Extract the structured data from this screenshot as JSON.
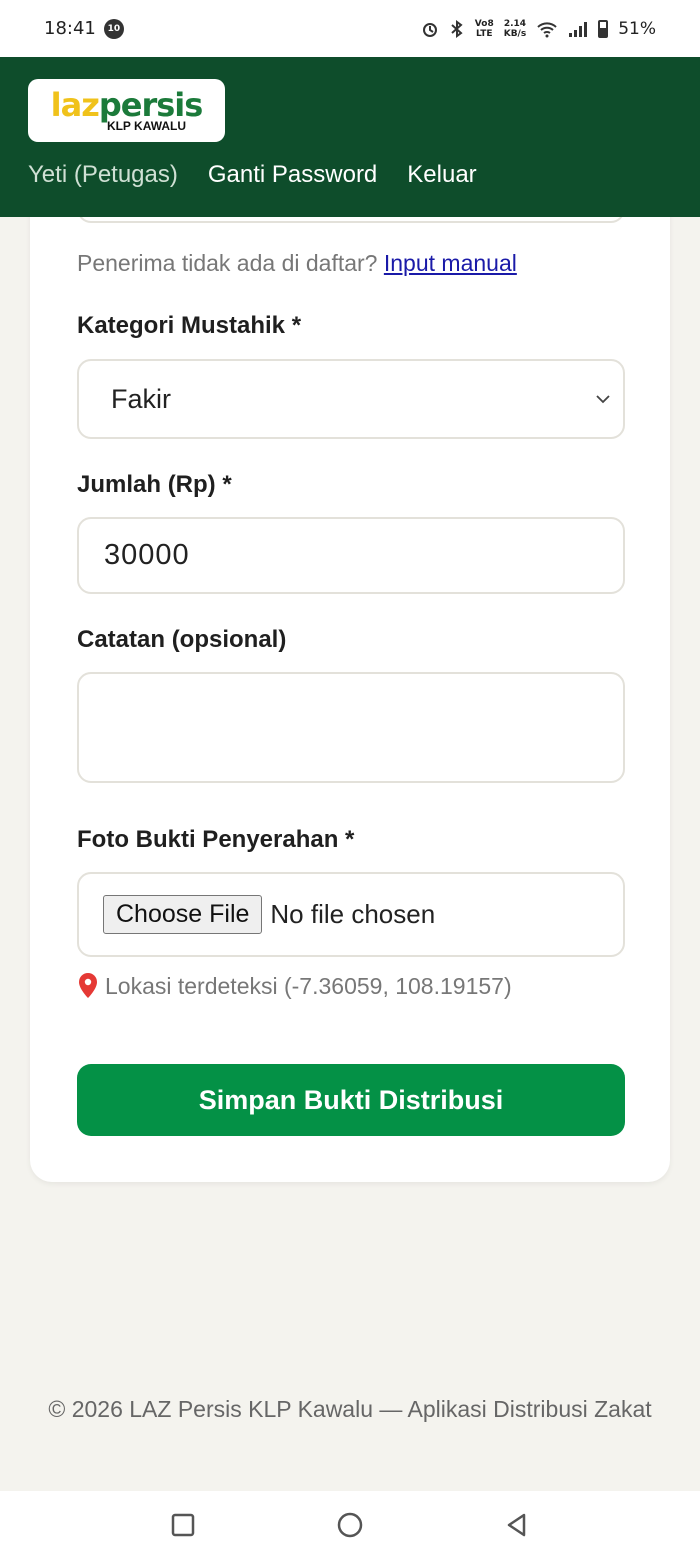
{
  "status_bar": {
    "time": "18:41",
    "notification_badge": "10",
    "net_line1": "Vo8",
    "net_line2": "LTE",
    "speed_value": "2.14",
    "speed_unit": "KB/s",
    "battery": "51%"
  },
  "header": {
    "logo_main_1": "laz",
    "logo_main_2": "persis",
    "logo_sub": "KLP KAWALU",
    "nav": {
      "user": "Yeti (Petugas)",
      "change_password": "Ganti Password",
      "logout": "Keluar"
    }
  },
  "form": {
    "manual_prompt": "Penerima tidak ada di daftar?",
    "manual_link": "Input manual",
    "category_label": "Kategori Mustahik *",
    "category_value": "Fakir",
    "amount_label": "Jumlah (Rp) *",
    "amount_value": "30000",
    "note_label": "Catatan (opsional)",
    "note_value": "",
    "photo_label": "Foto Bukti Penyerahan *",
    "choose_file": "Choose File",
    "no_file": "No file chosen",
    "location_text": "Lokasi terdeteksi (-7.36059, 108.19157)",
    "submit": "Simpan Bukti Distribusi"
  },
  "footer": {
    "text": "© 2026 LAZ Persis KLP Kawalu — Aplikasi Distribusi Zakat"
  },
  "colors": {
    "header_bg": "#0e4d2b",
    "primary_button": "#049146",
    "link": "#1a1aa8"
  }
}
